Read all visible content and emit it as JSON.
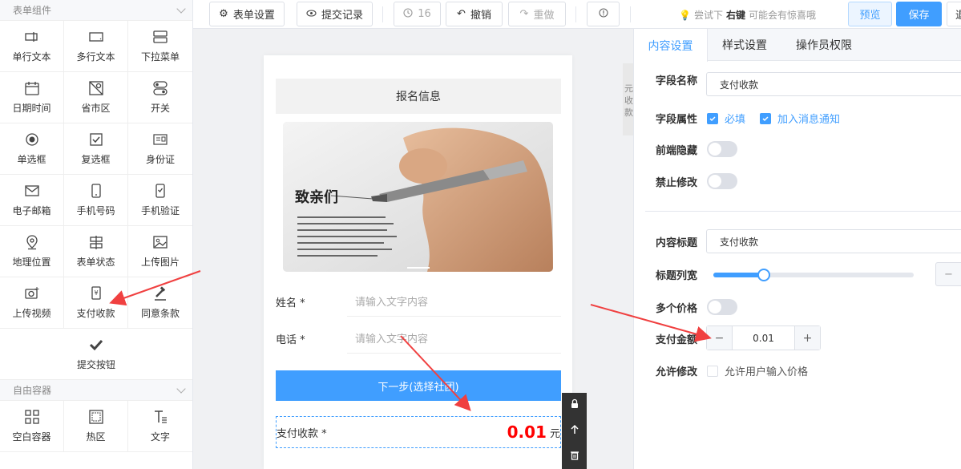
{
  "sidebar": {
    "section1_title": "表单组件",
    "items": [
      {
        "label": "单行文本",
        "icon": "single-line-text-icon"
      },
      {
        "label": "多行文本",
        "icon": "multi-line-text-icon"
      },
      {
        "label": "下拉菜单",
        "icon": "dropdown-menu-icon"
      },
      {
        "label": "日期时间",
        "icon": "calendar-icon"
      },
      {
        "label": "省市区",
        "icon": "map-region-icon"
      },
      {
        "label": "开关",
        "icon": "switch-icon"
      },
      {
        "label": "单选框",
        "icon": "radio-icon"
      },
      {
        "label": "复选框",
        "icon": "checkbox-icon"
      },
      {
        "label": "身份证",
        "icon": "id-card-icon"
      },
      {
        "label": "电子邮箱",
        "icon": "email-icon"
      },
      {
        "label": "手机号码",
        "icon": "phone-icon"
      },
      {
        "label": "手机验证",
        "icon": "phone-verify-icon"
      },
      {
        "label": "地理位置",
        "icon": "location-icon"
      },
      {
        "label": "表单状态",
        "icon": "form-status-icon"
      },
      {
        "label": "上传图片",
        "icon": "upload-image-icon"
      },
      {
        "label": "上传视频",
        "icon": "upload-video-icon"
      },
      {
        "label": "支付收款",
        "icon": "payment-icon"
      },
      {
        "label": "同意条款",
        "icon": "agree-terms-icon"
      }
    ],
    "submit_label": "提交按钮",
    "section2_title": "自由容器",
    "items2": [
      {
        "label": "空白容器",
        "icon": "blank-container-icon"
      },
      {
        "label": "热区",
        "icon": "hotspot-icon"
      },
      {
        "label": "文字",
        "icon": "text-icon"
      }
    ]
  },
  "toolbar": {
    "form_settings": "表单设置",
    "submit_records": "提交记录",
    "history_count": "16",
    "undo": "撤销",
    "redo": "重做",
    "hint_prefix": "尝试下",
    "hint_bold": "右键",
    "hint_suffix": "可能会有惊喜哦",
    "preview": "预览",
    "save": "保存",
    "cut_btn": "退"
  },
  "canvas": {
    "header_title": "报名信息",
    "banner_title": "致亲们",
    "fields": [
      {
        "label": "姓名",
        "required": "*",
        "placeholder": "请输入文字内容"
      },
      {
        "label": "电话",
        "required": "*",
        "placeholder": "请输入文字内容"
      }
    ],
    "next_button": "下一步(选择社团)",
    "payment": {
      "label": "支付收款",
      "required": "*",
      "amount": "0.01",
      "unit": "元"
    }
  },
  "strip_text": "元收款",
  "panel": {
    "tabs": [
      "内容设置",
      "样式设置",
      "操作员权限"
    ],
    "field_name_label": "字段名称",
    "field_name_value": "支付收款",
    "field_attr_label": "字段属性",
    "required_label": "必填",
    "notify_label": "加入消息通知",
    "frontend_hide_label": "前端隐藏",
    "no_edit_label": "禁止修改",
    "content_title_label": "内容标题",
    "content_title_value": "支付收款",
    "title_width_label": "标题列宽",
    "title_width_fraction": 0.25,
    "multi_price_label": "多个价格",
    "pay_amount_label": "支付金额",
    "pay_amount_value": "0.01",
    "allow_edit_label": "允许修改",
    "allow_edit_option": "允许用户输入价格",
    "mini_button": "−",
    "stepper_minus": "−",
    "stepper_plus": "+"
  },
  "colors": {
    "accent": "#409eff",
    "amount": "#ff0000",
    "arrow": "#f04040"
  }
}
